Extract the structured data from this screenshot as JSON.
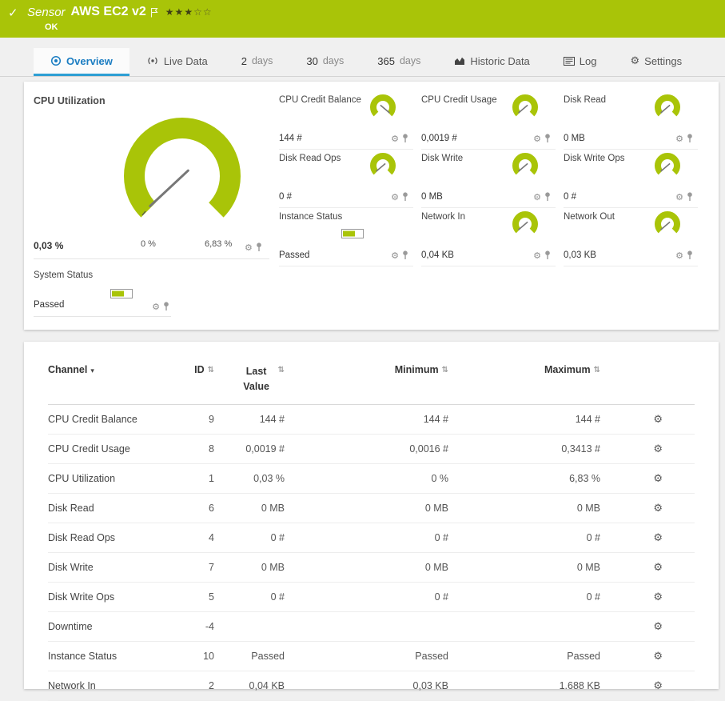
{
  "colors": {
    "brand": "#a9c408",
    "accent": "#1b7dc2"
  },
  "icons": {
    "check": "✓",
    "gear": "⚙",
    "sort": "⇅",
    "caret": "▾",
    "stars_filled": "★★★",
    "stars_empty": "☆☆"
  },
  "header": {
    "kind": "Sensor",
    "title": "AWS EC2 v2",
    "status": "OK"
  },
  "tabs": {
    "overview": {
      "label": "Overview"
    },
    "live_data": {
      "label": "Live Data"
    },
    "days2": {
      "num": "2",
      "unit": "days"
    },
    "days30": {
      "num": "30",
      "unit": "days"
    },
    "days365": {
      "num": "365",
      "unit": "days"
    },
    "historic": {
      "label": "Historic Data"
    },
    "log": {
      "label": "Log"
    },
    "settings": {
      "label": "Settings"
    }
  },
  "overview": {
    "main_gauge": {
      "title": "CPU Utilization",
      "value": "0,03 %",
      "scale_min": "0 %",
      "scale_max": "6,83 %"
    },
    "gauges": [
      {
        "title": "CPU Credit Balance",
        "value": "144 #",
        "type": "gauge",
        "needle": "max"
      },
      {
        "title": "CPU Credit Usage",
        "value": "0,0019 #",
        "type": "gauge",
        "needle": "min"
      },
      {
        "title": "Disk Read",
        "value": "0 MB",
        "type": "gauge",
        "needle": "min"
      },
      {
        "title": "Disk Read Ops",
        "value": "0 #",
        "type": "gauge",
        "needle": "min"
      },
      {
        "title": "Disk Write",
        "value": "0 MB",
        "type": "gauge",
        "needle": "min"
      },
      {
        "title": "Disk Write Ops",
        "value": "0 #",
        "type": "gauge",
        "needle": "min"
      },
      {
        "title": "Instance Status",
        "value": "Passed",
        "type": "status"
      },
      {
        "title": "Network In",
        "value": "0,04 KB",
        "type": "gauge",
        "needle": "min"
      },
      {
        "title": "Network Out",
        "value": "0,03 KB",
        "type": "gauge",
        "needle": "min"
      }
    ],
    "system_status": {
      "title": "System Status",
      "value": "Passed"
    }
  },
  "table": {
    "headers": {
      "channel": "Channel",
      "id": "ID",
      "last_value": "Last Value",
      "minimum": "Minimum",
      "maximum": "Maximum"
    },
    "rows": [
      {
        "channel": "CPU Credit Balance",
        "id": "9",
        "last": "144 #",
        "min": "144 #",
        "max": "144 #"
      },
      {
        "channel": "CPU Credit Usage",
        "id": "8",
        "last": "0,0019 #",
        "min": "0,0016 #",
        "max": "0,3413 #"
      },
      {
        "channel": "CPU Utilization",
        "id": "1",
        "last": "0,03 %",
        "min": "0 %",
        "max": "6,83 %"
      },
      {
        "channel": "Disk Read",
        "id": "6",
        "last": "0 MB",
        "min": "0 MB",
        "max": "0 MB"
      },
      {
        "channel": "Disk Read Ops",
        "id": "4",
        "last": "0 #",
        "min": "0 #",
        "max": "0 #"
      },
      {
        "channel": "Disk Write",
        "id": "7",
        "last": "0 MB",
        "min": "0 MB",
        "max": "0 MB"
      },
      {
        "channel": "Disk Write Ops",
        "id": "5",
        "last": "0 #",
        "min": "0 #",
        "max": "0 #"
      },
      {
        "channel": "Downtime",
        "id": "-4",
        "last": "",
        "min": "",
        "max": ""
      },
      {
        "channel": "Instance Status",
        "id": "10",
        "last": "Passed",
        "min": "Passed",
        "max": "Passed"
      },
      {
        "channel": "Network In",
        "id": "2",
        "last": "0,04 KB",
        "min": "0,03 KB",
        "max": "1.688 KB"
      }
    ]
  }
}
